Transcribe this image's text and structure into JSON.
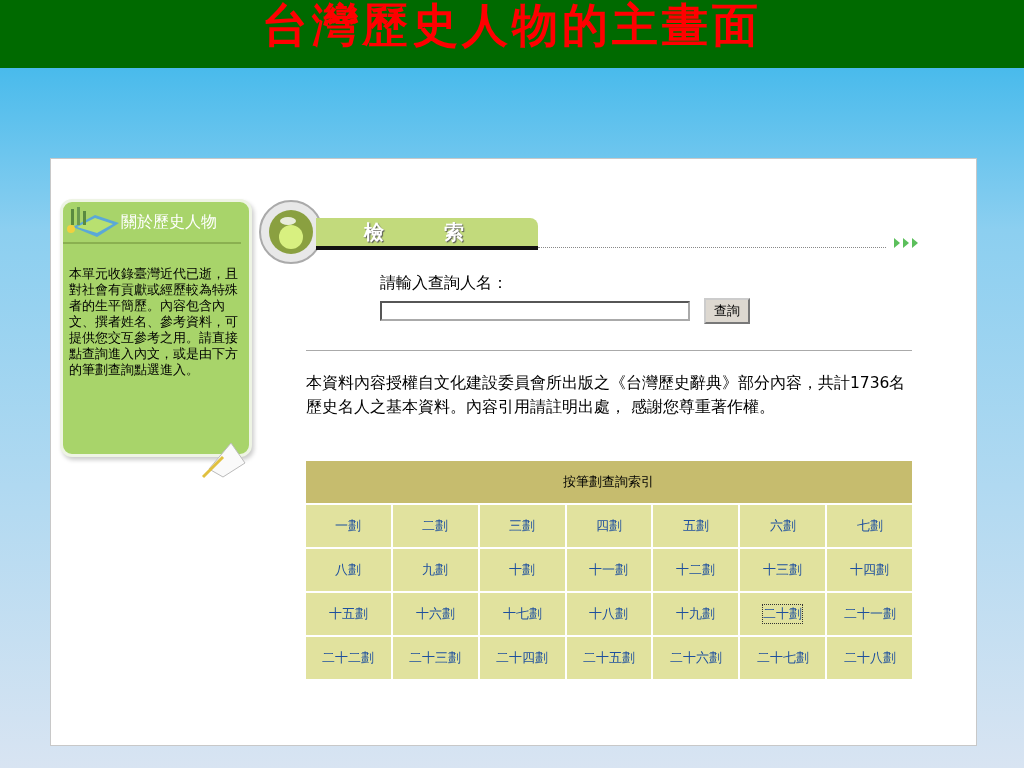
{
  "slide_title": "台灣歷史人物的主畫面",
  "sidebar": {
    "heading": "關於歷史人物",
    "text": "本單元收錄臺灣近代已逝，且對社會有貢獻或經歷較為特殊者的生平簡歷。內容包含內文、撰者姓名、參考資料，可提供您交互參考之用。請直接點查詢進入內文，或是由下方的筆劃查詢點選進入。"
  },
  "search": {
    "tab_chars": [
      "檢",
      "索"
    ],
    "label": "請輸入查詢人名：",
    "button": "查詢"
  },
  "notice": "本資料內容授權自文化建設委員會所出版之《台灣歷史辭典》部分內容，共計1736名歷史名人之基本資料。內容引用請註明出處， 感謝您尊重著作權。",
  "stroke_index": {
    "title": "按筆劃查詢索引",
    "links": [
      {
        "label": "一劃",
        "focused": false
      },
      {
        "label": "二劃",
        "focused": false
      },
      {
        "label": "三劃",
        "focused": false
      },
      {
        "label": "四劃",
        "focused": false
      },
      {
        "label": "五劃",
        "focused": false
      },
      {
        "label": "六劃",
        "focused": false
      },
      {
        "label": "七劃",
        "focused": false
      },
      {
        "label": "八劃",
        "focused": false
      },
      {
        "label": "九劃",
        "focused": false
      },
      {
        "label": "十劃",
        "focused": false
      },
      {
        "label": "十一劃",
        "focused": false
      },
      {
        "label": "十二劃",
        "focused": false
      },
      {
        "label": "十三劃",
        "focused": false
      },
      {
        "label": "十四劃",
        "focused": false
      },
      {
        "label": "十五劃",
        "focused": false
      },
      {
        "label": "十六劃",
        "focused": false
      },
      {
        "label": "十七劃",
        "focused": false
      },
      {
        "label": "十八劃",
        "focused": false
      },
      {
        "label": "十九劃",
        "focused": false
      },
      {
        "label": "二十劃",
        "focused": true
      },
      {
        "label": "二十一劃",
        "focused": false
      },
      {
        "label": "二十二劃",
        "focused": false
      },
      {
        "label": "二十三劃",
        "focused": false
      },
      {
        "label": "二十四劃",
        "focused": false
      },
      {
        "label": "二十五劃",
        "focused": false
      },
      {
        "label": "二十六劃",
        "focused": false
      },
      {
        "label": "二十七劃",
        "focused": false
      },
      {
        "label": "二十八劃",
        "focused": false
      }
    ]
  }
}
